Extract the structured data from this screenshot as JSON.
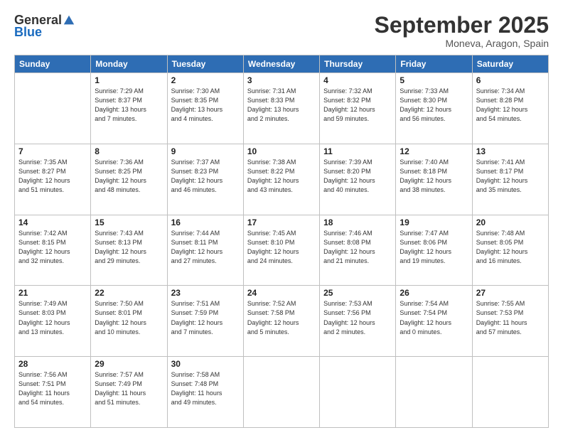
{
  "header": {
    "logo_general": "General",
    "logo_blue": "Blue",
    "title": "September 2025",
    "location": "Moneva, Aragon, Spain"
  },
  "weekdays": [
    "Sunday",
    "Monday",
    "Tuesday",
    "Wednesday",
    "Thursday",
    "Friday",
    "Saturday"
  ],
  "weeks": [
    [
      {
        "day": "",
        "info": ""
      },
      {
        "day": "1",
        "info": "Sunrise: 7:29 AM\nSunset: 8:37 PM\nDaylight: 13 hours\nand 7 minutes."
      },
      {
        "day": "2",
        "info": "Sunrise: 7:30 AM\nSunset: 8:35 PM\nDaylight: 13 hours\nand 4 minutes."
      },
      {
        "day": "3",
        "info": "Sunrise: 7:31 AM\nSunset: 8:33 PM\nDaylight: 13 hours\nand 2 minutes."
      },
      {
        "day": "4",
        "info": "Sunrise: 7:32 AM\nSunset: 8:32 PM\nDaylight: 12 hours\nand 59 minutes."
      },
      {
        "day": "5",
        "info": "Sunrise: 7:33 AM\nSunset: 8:30 PM\nDaylight: 12 hours\nand 56 minutes."
      },
      {
        "day": "6",
        "info": "Sunrise: 7:34 AM\nSunset: 8:28 PM\nDaylight: 12 hours\nand 54 minutes."
      }
    ],
    [
      {
        "day": "7",
        "info": "Sunrise: 7:35 AM\nSunset: 8:27 PM\nDaylight: 12 hours\nand 51 minutes."
      },
      {
        "day": "8",
        "info": "Sunrise: 7:36 AM\nSunset: 8:25 PM\nDaylight: 12 hours\nand 48 minutes."
      },
      {
        "day": "9",
        "info": "Sunrise: 7:37 AM\nSunset: 8:23 PM\nDaylight: 12 hours\nand 46 minutes."
      },
      {
        "day": "10",
        "info": "Sunrise: 7:38 AM\nSunset: 8:22 PM\nDaylight: 12 hours\nand 43 minutes."
      },
      {
        "day": "11",
        "info": "Sunrise: 7:39 AM\nSunset: 8:20 PM\nDaylight: 12 hours\nand 40 minutes."
      },
      {
        "day": "12",
        "info": "Sunrise: 7:40 AM\nSunset: 8:18 PM\nDaylight: 12 hours\nand 38 minutes."
      },
      {
        "day": "13",
        "info": "Sunrise: 7:41 AM\nSunset: 8:17 PM\nDaylight: 12 hours\nand 35 minutes."
      }
    ],
    [
      {
        "day": "14",
        "info": "Sunrise: 7:42 AM\nSunset: 8:15 PM\nDaylight: 12 hours\nand 32 minutes."
      },
      {
        "day": "15",
        "info": "Sunrise: 7:43 AM\nSunset: 8:13 PM\nDaylight: 12 hours\nand 29 minutes."
      },
      {
        "day": "16",
        "info": "Sunrise: 7:44 AM\nSunset: 8:11 PM\nDaylight: 12 hours\nand 27 minutes."
      },
      {
        "day": "17",
        "info": "Sunrise: 7:45 AM\nSunset: 8:10 PM\nDaylight: 12 hours\nand 24 minutes."
      },
      {
        "day": "18",
        "info": "Sunrise: 7:46 AM\nSunset: 8:08 PM\nDaylight: 12 hours\nand 21 minutes."
      },
      {
        "day": "19",
        "info": "Sunrise: 7:47 AM\nSunset: 8:06 PM\nDaylight: 12 hours\nand 19 minutes."
      },
      {
        "day": "20",
        "info": "Sunrise: 7:48 AM\nSunset: 8:05 PM\nDaylight: 12 hours\nand 16 minutes."
      }
    ],
    [
      {
        "day": "21",
        "info": "Sunrise: 7:49 AM\nSunset: 8:03 PM\nDaylight: 12 hours\nand 13 minutes."
      },
      {
        "day": "22",
        "info": "Sunrise: 7:50 AM\nSunset: 8:01 PM\nDaylight: 12 hours\nand 10 minutes."
      },
      {
        "day": "23",
        "info": "Sunrise: 7:51 AM\nSunset: 7:59 PM\nDaylight: 12 hours\nand 7 minutes."
      },
      {
        "day": "24",
        "info": "Sunrise: 7:52 AM\nSunset: 7:58 PM\nDaylight: 12 hours\nand 5 minutes."
      },
      {
        "day": "25",
        "info": "Sunrise: 7:53 AM\nSunset: 7:56 PM\nDaylight: 12 hours\nand 2 minutes."
      },
      {
        "day": "26",
        "info": "Sunrise: 7:54 AM\nSunset: 7:54 PM\nDaylight: 12 hours\nand 0 minutes."
      },
      {
        "day": "27",
        "info": "Sunrise: 7:55 AM\nSunset: 7:53 PM\nDaylight: 11 hours\nand 57 minutes."
      }
    ],
    [
      {
        "day": "28",
        "info": "Sunrise: 7:56 AM\nSunset: 7:51 PM\nDaylight: 11 hours\nand 54 minutes."
      },
      {
        "day": "29",
        "info": "Sunrise: 7:57 AM\nSunset: 7:49 PM\nDaylight: 11 hours\nand 51 minutes."
      },
      {
        "day": "30",
        "info": "Sunrise: 7:58 AM\nSunset: 7:48 PM\nDaylight: 11 hours\nand 49 minutes."
      },
      {
        "day": "",
        "info": ""
      },
      {
        "day": "",
        "info": ""
      },
      {
        "day": "",
        "info": ""
      },
      {
        "day": "",
        "info": ""
      }
    ]
  ]
}
